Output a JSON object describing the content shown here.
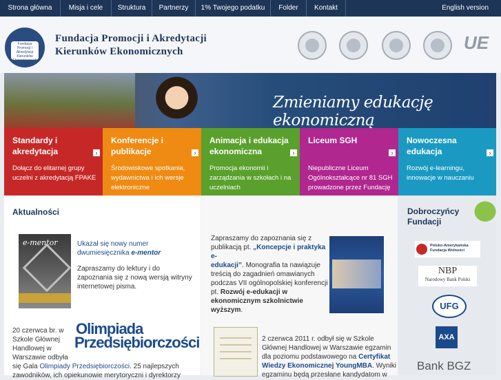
{
  "nav": {
    "items": [
      "Strona główna",
      "Misja i cele",
      "Struktura",
      "Partnerzy",
      "1% Twojego podatku",
      "Folder",
      "Kontakt"
    ],
    "english": "English version"
  },
  "header": {
    "org_line1": "Fundacja Promocji i Akredytacji",
    "org_line2": "Kierunków Ekonomicznych",
    "logo_text": "Fundacja Promocji i Akredytacji Kierunków Ekonomicznych"
  },
  "banner": {
    "slogan": "Zmieniamy edukację ekonomiczną"
  },
  "tiles": [
    {
      "title": "Standardy i akredytacja",
      "desc": "Dołącz do elitarnej grupy uczelni z akredytacją FPAKE",
      "color": "#c62828"
    },
    {
      "title": "Konferencje i publikacje",
      "desc": "Środowiskowe spotkania, wydawnictwa i ich wersje elektroniczne",
      "color": "#ef8a12"
    },
    {
      "title": "Animacja i edukacja ekonomiczna",
      "desc": "Promocja ekonomii i zarządzania w szkołach i na uczelniach",
      "color": "#5aa02c"
    },
    {
      "title": "Liceum SGH",
      "desc": "Niepubliczne Liceum Ogólnokształcące nr 81 SGH prowadzone przez Fundację",
      "color": "#b0278f"
    },
    {
      "title": "Nowoczesna edukacja",
      "desc": "Rozwój e-learningu, innowacje w nauczaniu",
      "color": "#1a9ac2"
    }
  ],
  "news": {
    "title": "Aktualności",
    "emag_title": "e-mentor",
    "item1_line1": "Ukazał się nowy numer",
    "item1_line2": "dwumiesięcznika",
    "item1_em": "e-mentor",
    "item1_p2a": "Zapraszamy do lektury i do",
    "item1_p2b": "zapoznania się z nową wersją witryny",
    "item1_p2c": "internetowej pisma.",
    "item2_a": "20 czerwca br. w",
    "item2_b": "Szkole Głównej",
    "item2_c": "Handlowej w",
    "item2_d": "Warszawie odbyła",
    "item2_e1": "się Gala ",
    "item2_e_link": "Olimpiady Przedsiębiorczości",
    "item2_e2": ". 25 najlepszych",
    "item2_f": "zawodników, ich opiekunowie merytoryczni i dyrektorzy",
    "olimp_1": "Olimpiada",
    "olimp_2": "Przedsiębiorczości"
  },
  "mid": {
    "p1_a": "Zapraszamy do zapoznania się z",
    "p1_b": "publikacją pt. ",
    "p1_b_link": "„Koncepcje i praktyka e-",
    "p1_c_link": "edukacji”",
    "p1_c": ". Monografia ta nawiązuje",
    "p1_d": "treścią do zagadnień omawianych",
    "p1_e": "podczas VII ogólnopolskiej konferencji",
    "p1_f1": "pt. ",
    "p1_f_bold": "Rozwój e-edukacji w",
    "p1_g_bold": "ekonomicznym szkolnictwie",
    "p1_h_bold": "wyższym",
    "p1_h": ".",
    "p2_a": "2 czerwca 2011 r. odbył się w Szkole",
    "p2_b": "Głównej Handlowej w Warszawie egzamin",
    "p2_c1": "dla poziomu podstawowego na ",
    "p2_c_link": "Certyfikat",
    "p2_d_link": "Wiedzy Ekonomicznej YoungMBA",
    "p2_d": ". Wyniki",
    "p2_e": "egzaminu będą przesłane kandydatom w"
  },
  "donors": {
    "title_1": "Dobroczyńcy",
    "title_2": "Fundacji",
    "s1_1": "Polsko-Amerykańska",
    "s1_2": "Fundacja Wolności",
    "s2_logo": "NBP",
    "s2_name": "Narodowy Bank Polski",
    "s3": "UFG",
    "s4": "AXA",
    "s5": "Bank BGZ"
  }
}
